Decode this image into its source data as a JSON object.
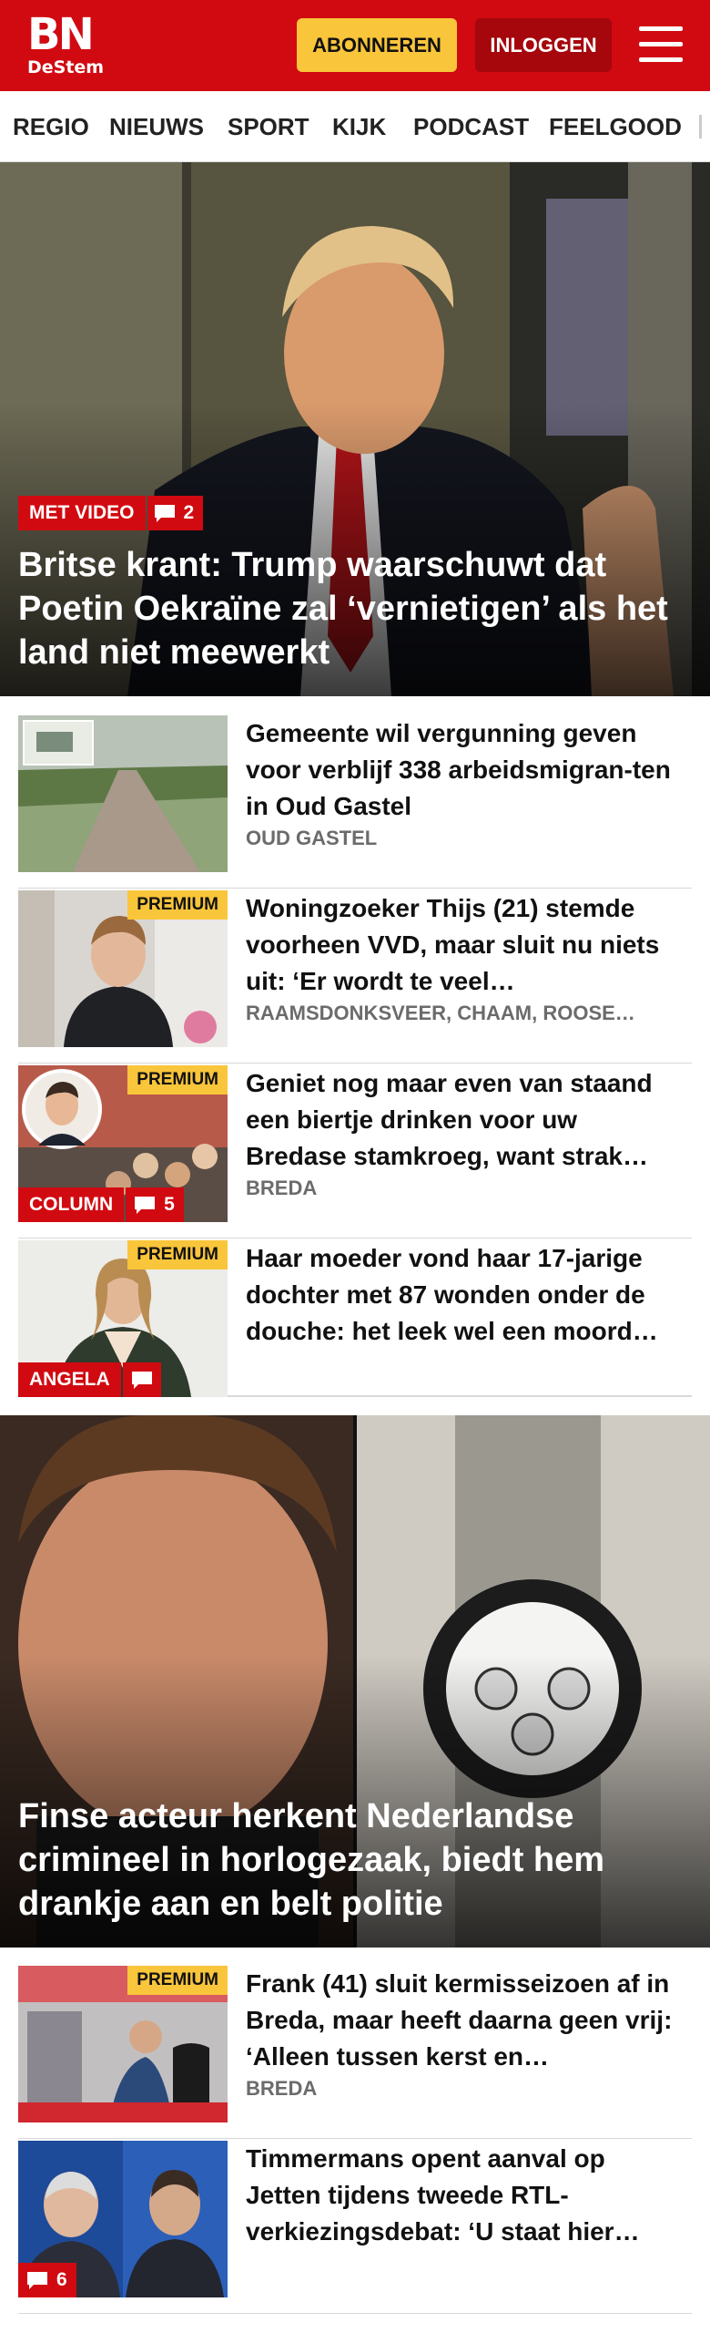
{
  "header": {
    "logo_line1": "BN",
    "logo_line2": "DeStem",
    "subscribe_label": "ABONNEREN",
    "login_label": "INLOGGEN",
    "brand_color": "#d10a11",
    "subscribe_color": "#f9c53b"
  },
  "nav": {
    "items": [
      "REGIO",
      "NIEUWS",
      "SPORT",
      "KIJK",
      "PODCAST",
      "FEELGOOD"
    ]
  },
  "hero1": {
    "badge": "MET VIDEO",
    "comments": "2",
    "title": "Britse krant: Trump waarschuwt dat Poetin Oekraïne zal ‘vernietigen’ als het land niet meewerkt"
  },
  "articles": [
    {
      "title": "Gemeente wil vergunning geven voor verblijf 338 arbeidsmigran-ten in Oud Gastel",
      "sub": "OUD GASTEL"
    },
    {
      "premium": "PREMIUM",
      "title": "Woningzoeker Thijs (21) stemde voorheen VVD, maar sluit nu niets uit: ‘Er wordt te veel…",
      "sub": "RAAMSDONKSVEER, CHAAM, ROOSE…"
    },
    {
      "premium": "PREMIUM",
      "badge": "COLUMN",
      "comments": "5",
      "title": "Geniet nog maar even van staand een biertje drinken voor uw Bredase stamkroeg, want strak…",
      "sub": "BREDA"
    },
    {
      "premium": "PREMIUM",
      "badge": "ANGELA",
      "title": "Haar moeder vond haar 17-jarige dochter met 87 wonden onder de douche: het leek wel een moord…"
    }
  ],
  "hero2": {
    "title": "Finse acteur herkent Nederlandse crimineel in horlogezaak, biedt hem drankje aan en belt politie"
  },
  "articles2": [
    {
      "premium": "PREMIUM",
      "title": "Frank (41) sluit kermisseizoen af in Breda, maar heeft daarna geen vrij: ‘Alleen tussen kerst en…",
      "sub": "BREDA"
    },
    {
      "comments": "6",
      "title": "Timmermans opent aanval op Jetten tijdens tweede RTL-verkiezingsdebat: ‘U staat hier…"
    }
  ]
}
